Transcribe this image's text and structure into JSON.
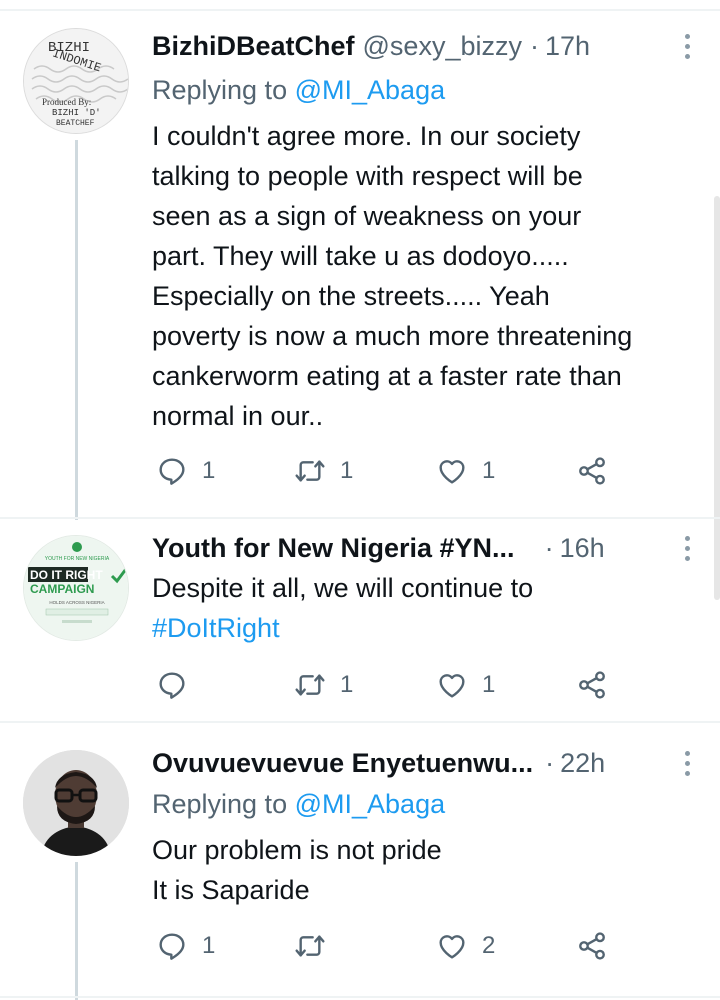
{
  "tweets": [
    {
      "display_name": "BizhiDBeatChef",
      "handle": "@sexy_bizzy",
      "separator": "·",
      "time": "17h",
      "replying_prefix": "Replying to",
      "replying_to": "@MI_Abaga",
      "body_lines": [
        "I couldn't agree more. In our society",
        "talking to people with respect will be",
        "seen as a sign of weakness on your",
        "part. They will take u as dodoyo.....",
        "Especially on the streets..... Yeah",
        "poverty is now a much more threatening",
        "cankerworm eating at a faster rate than",
        "normal in our.."
      ],
      "avatar_text": [
        "BIZHI",
        "INDOMIE",
        "Produced By:",
        "BIZHI 'D'",
        "BEATCHEF"
      ],
      "replies": "1",
      "retweets": "1",
      "likes": "1"
    },
    {
      "display_name": "Youth for New Nigeria #YN...",
      "separator": "·",
      "time": "16h",
      "body_text": "Despite it all, we will continue to",
      "hashtag": "#DoItRight",
      "avatar_text": [
        "YOUTH FOR NEW NIGERIA",
        "DO IT RIGHT",
        "CAMPAIGN",
        "HOLDS ACROSS NIGERIA"
      ],
      "replies": "",
      "retweets": "1",
      "likes": "1"
    },
    {
      "display_name": "Ovuvuevuevue Enyetuenwu...",
      "separator": "·",
      "time": "22h",
      "replying_prefix": "Replying to",
      "replying_to": "@MI_Abaga",
      "body_lines": [
        "Our problem is not pride",
        "It is Saparide"
      ],
      "replies": "1",
      "retweets": "",
      "likes": "2"
    }
  ],
  "colors": {
    "accent": "#1d9bf0",
    "secondary_text": "#536471",
    "divider": "#eff3f4"
  },
  "icons": [
    "reply-icon",
    "retweet-icon",
    "like-icon",
    "share-icon",
    "more-options-icon"
  ]
}
